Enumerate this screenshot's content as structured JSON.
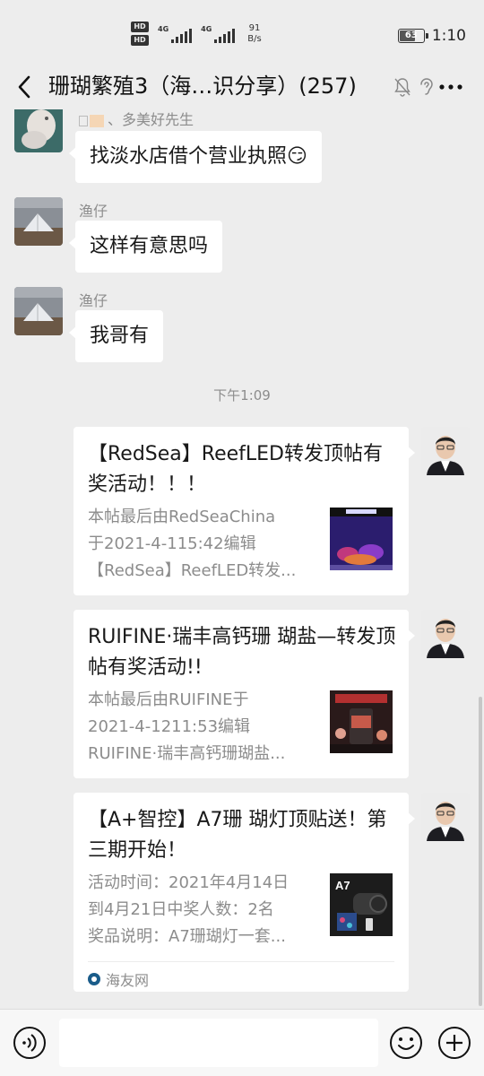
{
  "status_bar": {
    "hd1": "HD",
    "hd2": "HD",
    "sig1_label": "4G",
    "sig2_label": "4G",
    "speed_value": "91",
    "speed_unit": "B/s",
    "battery": "63",
    "time": "1:10"
  },
  "header": {
    "back_icon": "chevron-left-icon",
    "title": "珊瑚繁殖3（海…识分享）(257)",
    "mute_icon": "bell-off-icon",
    "ear_icon": "ear-icon",
    "more_icon": "more-dots-icon"
  },
  "messages": [
    {
      "sender": "、多美好先生",
      "text": "找淡水店借个营业执照😏",
      "side": "left"
    },
    {
      "sender": "渔仔",
      "text": "这样有意思吗",
      "side": "left"
    },
    {
      "sender": "渔仔",
      "text": "我哥有",
      "side": "left"
    }
  ],
  "time_separator": "下午1:09",
  "cards": [
    {
      "title": "【RedSea】ReefLED转发顶帖有奖活动！！！",
      "desc": [
        "本帖最后由RedSeaChina",
        "于2021-4-115:42编辑",
        "【RedSea】ReefLED转发..."
      ],
      "thumb_icon": "aquarium-thumbnail"
    },
    {
      "title": "RUIFINE·瑞丰高钙珊 瑚盐—转发顶帖有奖活动!!",
      "desc": [
        "本帖最后由RUIFINE于",
        "2021-4-1211:53编辑",
        "RUIFINE·瑞丰高钙珊瑚盐..."
      ],
      "thumb_icon": "salt-bucket-thumbnail"
    },
    {
      "title": "【A+智控】A7珊 瑚灯顶贴送！第三期开始！",
      "desc": [
        "活动时间：2021年4月14日",
        "到4月21日中奖人数：2名",
        "奖品说明：A7珊瑚灯一套..."
      ],
      "thumb_icon": "a7-lamp-thumbnail",
      "thumb_label": "A7",
      "source": "海友网"
    }
  ],
  "input_bar": {
    "voice_icon": "voice-icon",
    "placeholder": "",
    "emoji_icon": "emoji-icon",
    "plus_icon": "plus-icon"
  },
  "colors": {
    "background": "#ededed",
    "bubble": "#ffffff",
    "secondary_text": "#8c8c8c"
  }
}
